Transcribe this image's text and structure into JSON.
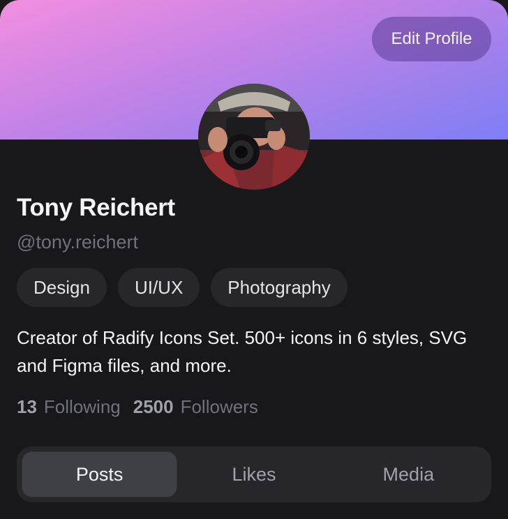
{
  "header": {
    "edit_label": "Edit Profile"
  },
  "profile": {
    "name": "Tony Reichert",
    "handle": "@tony.reichert",
    "bio": "Creator of Radify Icons Set. 500+ icons in 6 styles, SVG and Figma files, and more."
  },
  "tags": [
    "Design",
    "UI/UX",
    "Photography"
  ],
  "stats": {
    "following_count": "13",
    "following_label": "Following",
    "followers_count": "2500",
    "followers_label": "Followers"
  },
  "tabs": [
    {
      "label": "Posts",
      "active": true
    },
    {
      "label": "Likes",
      "active": false
    },
    {
      "label": "Media",
      "active": false
    }
  ],
  "colors": {
    "banner_start": "#f28fe0",
    "banner_end": "#7f7ef7",
    "card_bg": "#18181b",
    "chip_bg": "#27272a"
  }
}
